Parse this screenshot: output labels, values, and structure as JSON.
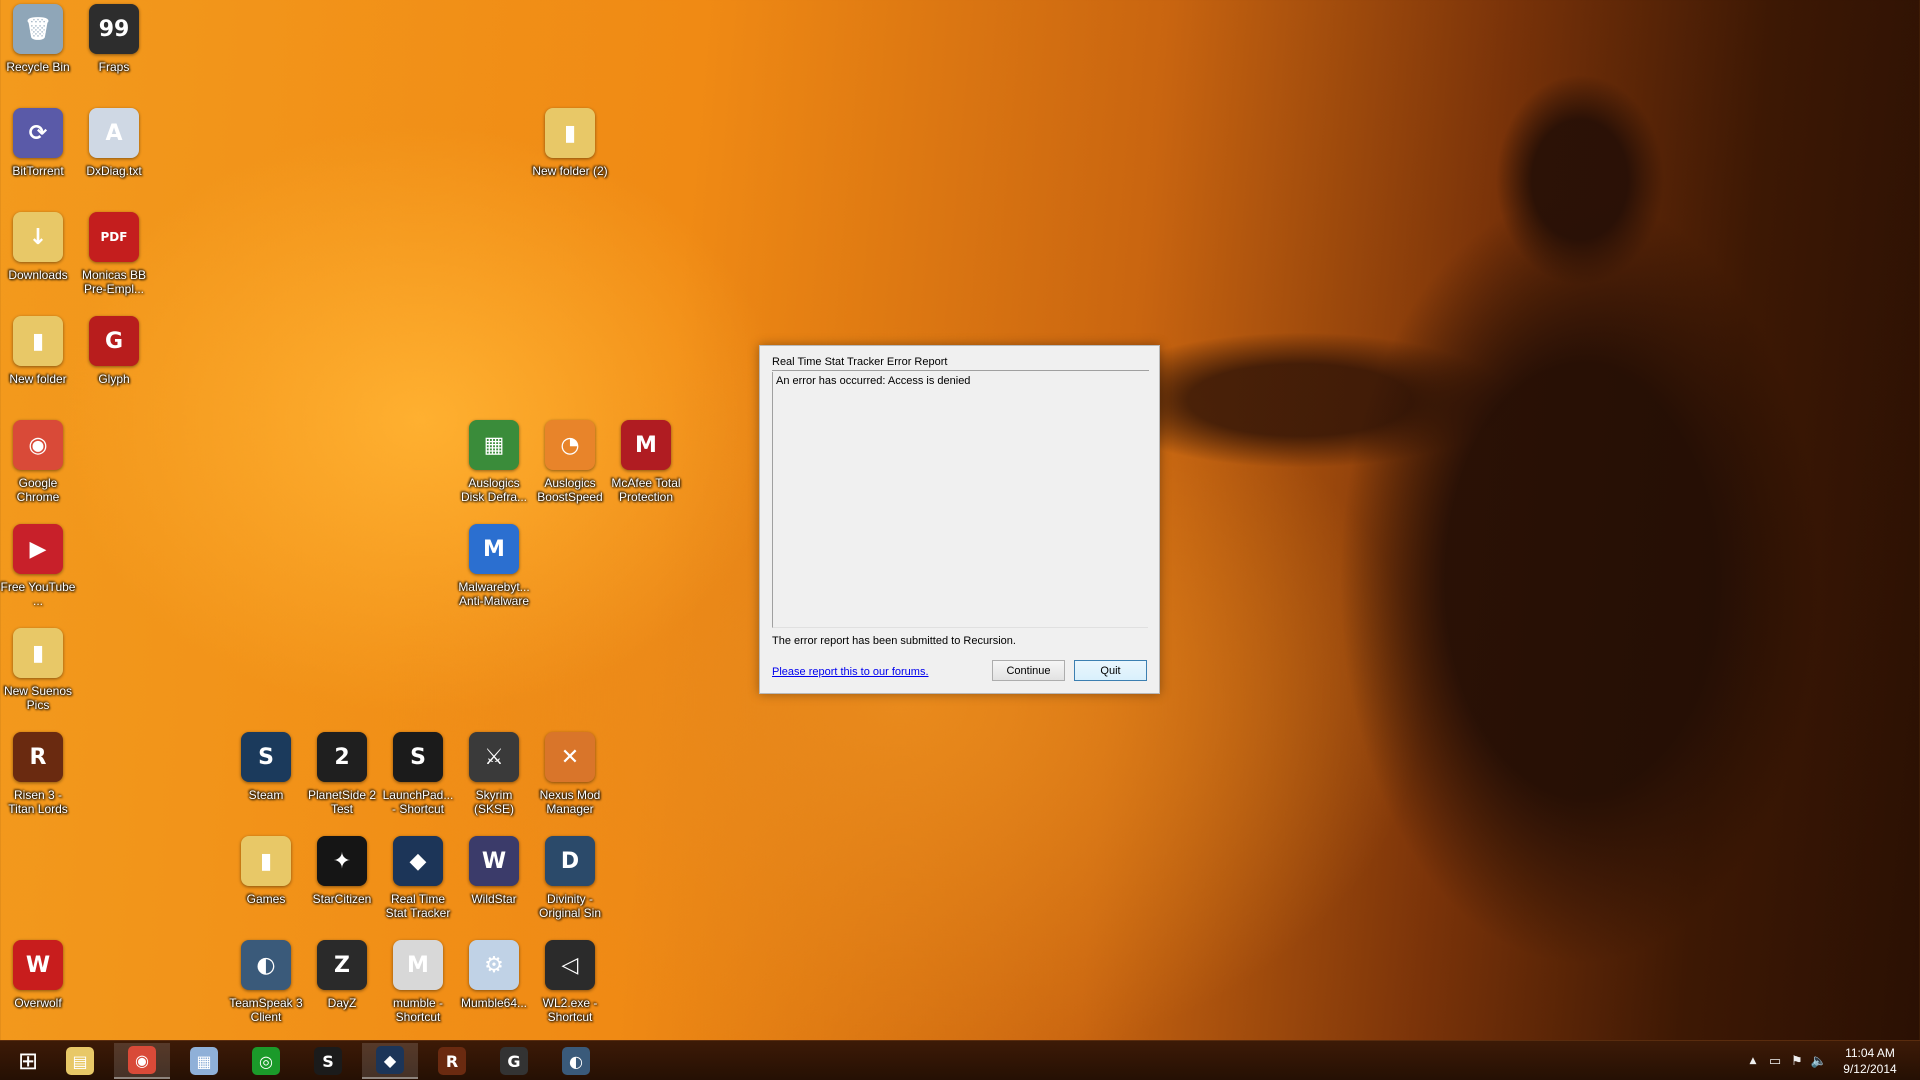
{
  "desktop": {
    "icons": [
      {
        "label": "Recycle Bin",
        "glyph": "🗑",
        "color": "#8fa6b8",
        "icon": "recycle-bin-icon"
      },
      {
        "label": "Fraps",
        "glyph": "99",
        "color": "#2d2d2d",
        "icon": "fraps-icon"
      },
      {
        "label": "BitTorrent",
        "glyph": "⟳",
        "color": "#5a5aa8",
        "icon": "bittorrent-icon"
      },
      {
        "label": "DxDiag.txt",
        "glyph": "A",
        "color": "#cfd8e4",
        "icon": "text-file-icon"
      },
      {
        "label": "New folder (2)",
        "glyph": "▮",
        "color": "#e8c867",
        "icon": "folder-icon"
      },
      {
        "label": "Downloads",
        "glyph": "↓",
        "color": "#e8c867",
        "icon": "downloads-folder-icon"
      },
      {
        "label": "Monicas BB Pre-Empl...",
        "glyph": "PDF",
        "color": "#c41e1e",
        "icon": "pdf-icon"
      },
      {
        "label": "New folder",
        "glyph": "▮",
        "color": "#e8c867",
        "icon": "folder-icon"
      },
      {
        "label": "Glyph",
        "glyph": "G",
        "color": "#b81d1d",
        "icon": "glyph-icon"
      },
      {
        "label": "Google Chrome",
        "glyph": "◉",
        "color": "#d94a38",
        "icon": "chrome-icon"
      },
      {
        "label": "Auslogics Disk Defra...",
        "glyph": "▦",
        "color": "#3a8c3a",
        "icon": "defrag-icon"
      },
      {
        "label": "Auslogics BoostSpeed",
        "glyph": "◔",
        "color": "#e8842a",
        "icon": "boostspeed-icon"
      },
      {
        "label": "McAfee Total Protection",
        "glyph": "M",
        "color": "#b01c22",
        "icon": "mcafee-icon"
      },
      {
        "label": "Free YouTube ...",
        "glyph": "▶",
        "color": "#c8202a",
        "icon": "youtube-downloader-icon"
      },
      {
        "label": "Malwarebyt... Anti-Malware",
        "glyph": "M",
        "color": "#2b6fd0",
        "icon": "malwarebytes-icon"
      },
      {
        "label": "New Suenos Pics",
        "glyph": "▮",
        "color": "#e8c867",
        "icon": "folder-icon"
      },
      {
        "label": "Risen 3 - Titan Lords",
        "glyph": "R",
        "color": "#6a2a10",
        "icon": "risen-icon"
      },
      {
        "label": "Steam",
        "glyph": "S",
        "color": "#1b3a5c",
        "icon": "steam-icon"
      },
      {
        "label": "PlanetSide 2 Test",
        "glyph": "2",
        "color": "#1f1f1f",
        "icon": "planetside-icon"
      },
      {
        "label": "LaunchPad... - Shortcut",
        "glyph": "S",
        "color": "#1b1b1b",
        "icon": "launchpad-icon"
      },
      {
        "label": "Skyrim (SKSE)",
        "glyph": "⚔",
        "color": "#3a3a3a",
        "icon": "skyrim-icon"
      },
      {
        "label": "Nexus Mod Manager",
        "glyph": "✕",
        "color": "#d9752a",
        "icon": "nexus-icon"
      },
      {
        "label": "Games",
        "glyph": "▮",
        "color": "#e8c867",
        "icon": "folder-icon"
      },
      {
        "label": "StarCitizen",
        "glyph": "✦",
        "color": "#151515",
        "icon": "starcitizen-icon"
      },
      {
        "label": "Real Time Stat Tracker",
        "glyph": "◆",
        "color": "#1c3558",
        "icon": "stat-tracker-icon"
      },
      {
        "label": "WildStar",
        "glyph": "W",
        "color": "#3b3b6a",
        "icon": "wildstar-icon"
      },
      {
        "label": "Divinity - Original Sin",
        "glyph": "D",
        "color": "#2b4a6a",
        "icon": "divinity-icon"
      },
      {
        "label": "Overwolf",
        "glyph": "W",
        "color": "#c81d1d",
        "icon": "overwolf-icon"
      },
      {
        "label": "TeamSpeak 3 Client",
        "glyph": "◐",
        "color": "#3a5a7a",
        "icon": "teamspeak-icon"
      },
      {
        "label": "DayZ",
        "glyph": "Z",
        "color": "#2a2a2a",
        "icon": "dayz-icon"
      },
      {
        "label": "mumble - Shortcut",
        "glyph": "M",
        "color": "#d8d8d8",
        "icon": "mumble-icon"
      },
      {
        "label": "Mumble64...",
        "glyph": "⚙",
        "color": "#c0d2e6",
        "icon": "mumble64-icon"
      },
      {
        "label": "WL2.exe - Shortcut",
        "glyph": "◁",
        "color": "#2b2b2b",
        "icon": "unity-icon"
      }
    ]
  },
  "dialog": {
    "title": "Real Time Stat Tracker Error Report",
    "error_text": "An error has occurred: Access is denied",
    "status": "The error report has been submitted to Recursion.",
    "link": "Please report this to our forums.",
    "continue_label": "Continue",
    "quit_label": "Quit"
  },
  "taskbar": {
    "items": [
      {
        "name": "start",
        "glyph": "⊞",
        "color": "transparent"
      },
      {
        "name": "file-explorer",
        "glyph": "▤",
        "color": "#e8c867"
      },
      {
        "name": "chrome",
        "glyph": "◉",
        "color": "#d94a38"
      },
      {
        "name": "calculator",
        "glyph": "▦",
        "color": "#8fb0d8"
      },
      {
        "name": "razer",
        "glyph": "◎",
        "color": "#1b9a2a"
      },
      {
        "name": "launchpad",
        "glyph": "S",
        "color": "#1b1b1b"
      },
      {
        "name": "stat-tracker",
        "glyph": "◆",
        "color": "#1c3558"
      },
      {
        "name": "risen",
        "glyph": "R",
        "color": "#6a2a10"
      },
      {
        "name": "glyph",
        "glyph": "G",
        "color": "#333333"
      },
      {
        "name": "teamspeak",
        "glyph": "◐",
        "color": "#3a5a7a"
      }
    ],
    "tray": {
      "chevron": "▲",
      "network": "▭",
      "flag": "⚑",
      "volume": "🔈"
    },
    "time": "11:04 AM",
    "date": "9/12/2014"
  }
}
